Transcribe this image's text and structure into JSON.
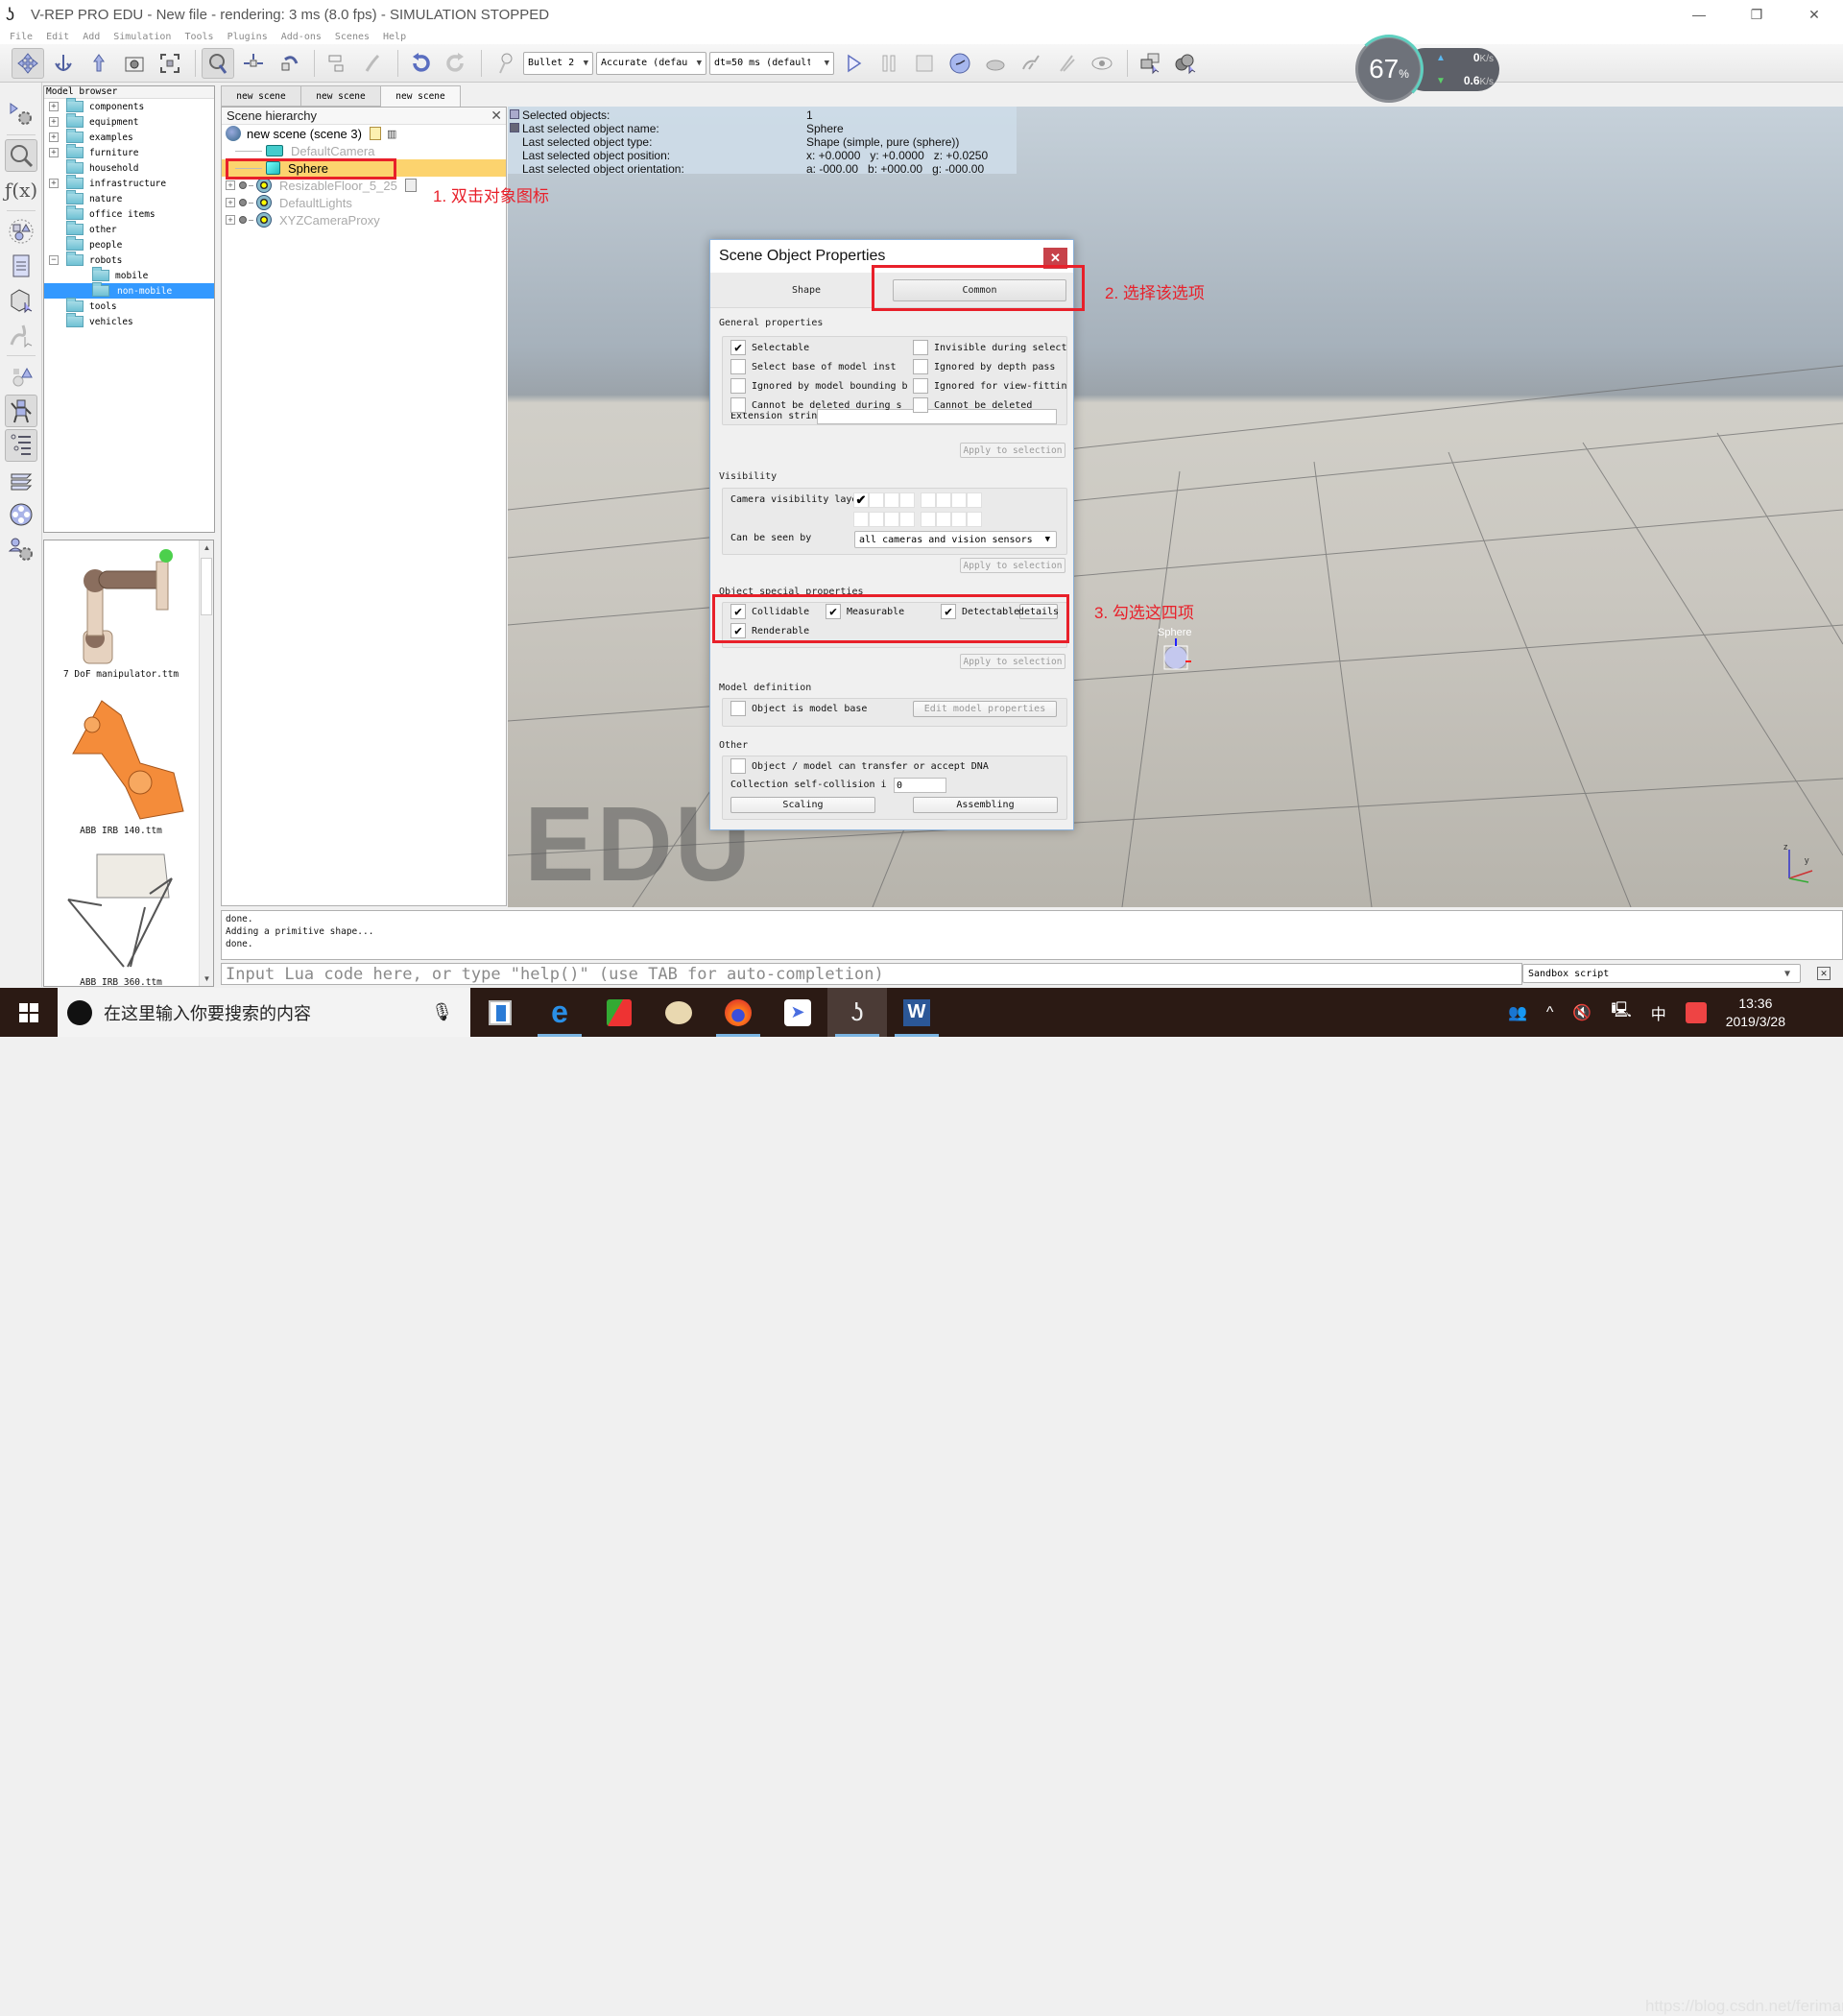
{
  "window": {
    "title": "V-REP PRO EDU - New file - rendering: 3 ms (8.0 fps) - SIMULATION STOPPED",
    "controls": [
      "minimize",
      "restore",
      "close"
    ]
  },
  "menu": [
    "File",
    "Edit",
    "Add",
    "Simulation",
    "Tools",
    "Plugins",
    "Add-ons",
    "Scenes",
    "Help"
  ],
  "toolbar": {
    "physics_engine": "Bullet 2",
    "accuracy": "Accurate (defau",
    "timestep": "dt=50 ms (default)"
  },
  "perf_widget": {
    "percent": "67",
    "percent_unit": "%",
    "upload": "0",
    "download": "0.6",
    "unit": "K/s"
  },
  "model_browser": {
    "title": "Model browser",
    "folders": [
      {
        "label": "components",
        "expandable": true
      },
      {
        "label": "equipment",
        "expandable": true
      },
      {
        "label": "examples",
        "expandable": true
      },
      {
        "label": "furniture",
        "expandable": true
      },
      {
        "label": "household",
        "expandable": false
      },
      {
        "label": "infrastructure",
        "expandable": true
      },
      {
        "label": "nature",
        "expandable": false
      },
      {
        "label": "office items",
        "expandable": false
      },
      {
        "label": "other",
        "expandable": false
      },
      {
        "label": "people",
        "expandable": false
      },
      {
        "label": "robots",
        "expandable": true,
        "expanded": true
      },
      {
        "label": "mobile",
        "sub": true
      },
      {
        "label": "non-mobile",
        "sub": true,
        "selected": true
      },
      {
        "label": "tools",
        "expandable": false
      },
      {
        "label": "vehicles",
        "expandable": false
      }
    ],
    "thumbnails": [
      "7 DoF manipulator.ttm",
      "ABB IRB 140.ttm",
      "ABB IRB 360.ttm"
    ]
  },
  "scene_tabs": [
    "new scene",
    "new scene",
    "new scene"
  ],
  "hierarchy": {
    "title": "Scene hierarchy",
    "root": "new scene (scene 3)",
    "items": [
      "DefaultCamera",
      "Sphere",
      "ResizableFloor_5_25",
      "DefaultLights",
      "XYZCameraProxy"
    ]
  },
  "info": {
    "rows": [
      {
        "key": "Selected objects:",
        "value": "1"
      },
      {
        "key": "Last selected object name:",
        "value": "Sphere"
      },
      {
        "key": "Last selected object type:",
        "value": "Shape (simple, pure (sphere))"
      },
      {
        "key": "Last selected object position:",
        "value": "x: +0.0000   y: +0.0000   z: +0.0250"
      },
      {
        "key": "Last selected object orientation:",
        "value": "a: -000.00   b: +000.00   g: -000.00"
      }
    ]
  },
  "viewport": {
    "watermark": "EDU",
    "object_label": "Sphere"
  },
  "annotations": {
    "step1": "1. 双击对象图标",
    "step2": "2. 选择该选项",
    "step3": "3. 勾选这四项",
    "color": "#e8202a"
  },
  "dialog": {
    "title": "Scene Object Properties",
    "tabs": [
      "Shape",
      "Common"
    ],
    "general": {
      "title": "General properties",
      "checks": [
        {
          "label": "Selectable",
          "checked": true
        },
        {
          "label": "Invisible during select",
          "checked": false
        },
        {
          "label": "Select base of model inst",
          "checked": false
        },
        {
          "label": "Ignored by depth pass",
          "checked": false
        },
        {
          "label": "Ignored by model bounding  b",
          "checked": false
        },
        {
          "label": "Ignored for view-fittin",
          "checked": false
        },
        {
          "label": "Cannot be deleted during s",
          "checked": false
        },
        {
          "label": "Cannot be deleted",
          "checked": false
        }
      ],
      "extension_label": "Extension strin",
      "extension_value": "",
      "apply": "Apply to selection"
    },
    "visibility": {
      "title": "Visibility",
      "camera_layers_label": "Camera visibility laye",
      "layers_checked": [
        true,
        false,
        false,
        false,
        false,
        false,
        false,
        false,
        false,
        false,
        false,
        false,
        false,
        false,
        false,
        false
      ],
      "seen_by_label": "Can be seen by",
      "seen_by_value": "all cameras and vision sensors",
      "apply": "Apply to selection"
    },
    "special": {
      "title": "Object special properties",
      "checks": [
        {
          "label": "Collidable",
          "checked": true
        },
        {
          "label": "Measurable",
          "checked": true
        },
        {
          "label": "Detectable",
          "checked": true
        },
        {
          "label": "Renderable",
          "checked": true
        }
      ],
      "details": "details",
      "apply": "Apply to selection"
    },
    "model": {
      "title": "Model definition",
      "model_base_label": "Object is model base",
      "model_base_checked": false,
      "edit_button": "Edit model properties"
    },
    "other": {
      "title": "Other",
      "dna_label": "Object / model can transfer or accept DNA",
      "dna_checked": false,
      "collision_label": "Collection self-collision i",
      "collision_value": "0",
      "scaling": "Scaling",
      "assembling": "Assembling"
    }
  },
  "console": {
    "lines": [
      "done.",
      "Adding a primitive shape...",
      "done."
    ],
    "input_placeholder": "Input Lua code here, or type \"help()\" (use TAB for auto-completion)",
    "script_select": "Sandbox script"
  },
  "taskbar": {
    "search_placeholder": "在这里输入你要搜索的内容",
    "apps": [
      "task-view",
      "edge",
      "app-red",
      "paint",
      "firefox",
      "feishu",
      "v-rep",
      "word"
    ],
    "ime": "中",
    "time": "13:36",
    "date": "2019/3/28",
    "watermark": "https://blog.csdn.net/feriman"
  }
}
